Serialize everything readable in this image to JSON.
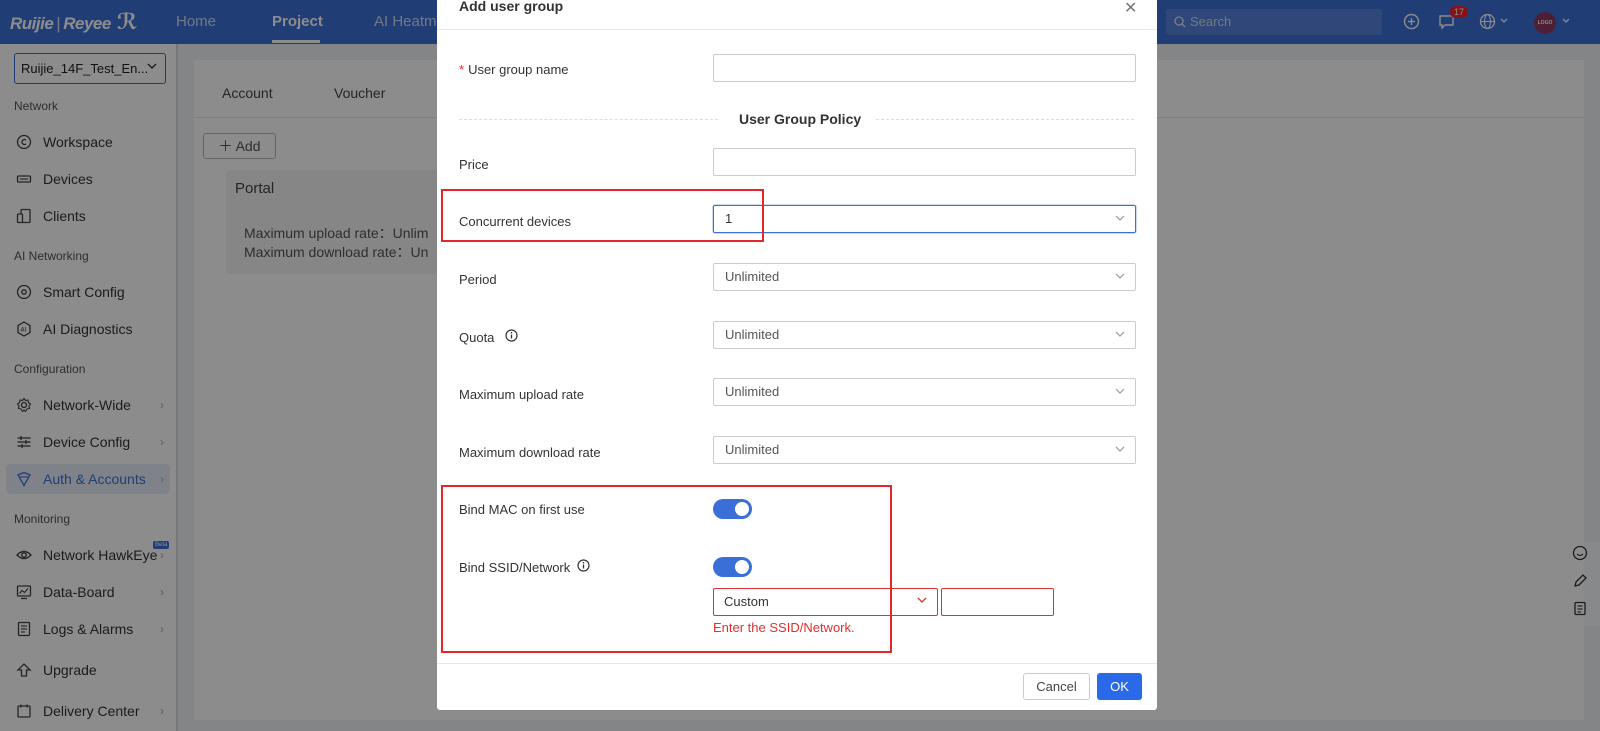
{
  "topbar": {
    "logo_brand": "Ruijie",
    "logo_sep": "|",
    "logo_sub": "Reyee",
    "nav": [
      "Home",
      "Project",
      "AI Heatm"
    ],
    "search_placeholder": "Search",
    "notification_count": "17",
    "avatar_text": "LOGO"
  },
  "sidebar": {
    "site": "Ruijie_14F_Test_En...",
    "sections": {
      "network": "Network",
      "ai": "AI Networking",
      "config": "Configuration",
      "monitoring": "Monitoring"
    },
    "items": {
      "workspace": "Workspace",
      "devices": "Devices",
      "clients": "Clients",
      "smart_config": "Smart Config",
      "ai_diagnostics": "AI Diagnostics",
      "network_wide": "Network-Wide",
      "device_config": "Device Config",
      "auth_accounts": "Auth & Accounts",
      "network_hawkeye": "Network HawkEye",
      "hawkeye_badge": "Beta",
      "data_board": "Data-Board",
      "logs_alarms": "Logs & Alarms",
      "upgrade": "Upgrade",
      "delivery_center": "Delivery Center"
    }
  },
  "background": {
    "tabs": [
      "Account",
      "Voucher"
    ],
    "add_label": "Add",
    "portal_title": "Portal",
    "portal_upload": "Maximum upload rate：Unlim",
    "portal_download": "Maximum download rate：Un"
  },
  "modal": {
    "title": "Add user group",
    "group_name_label": "User group name",
    "group_name_value": "",
    "policy_title": "User Group Policy",
    "price_label": "Price",
    "price_value": "",
    "concurrent_label": "Concurrent devices",
    "concurrent_value": "1",
    "period_label": "Period",
    "period_value": "Unlimited",
    "quota_label": "Quota",
    "quota_value": "Unlimited",
    "upload_label": "Maximum upload rate",
    "upload_value": "Unlimited",
    "download_label": "Maximum download rate",
    "download_value": "Unlimited",
    "bind_mac_label": "Bind MAC on first use",
    "bind_ssid_label": "Bind SSID/Network",
    "ssid_mode": "Custom",
    "ssid_value": "",
    "ssid_error": "Enter the SSID/Network.",
    "cancel_label": "Cancel",
    "ok_label": "OK"
  },
  "colors": {
    "primary": "#3b6fd8",
    "highlight": "#e5262b",
    "error": "#e03030"
  }
}
